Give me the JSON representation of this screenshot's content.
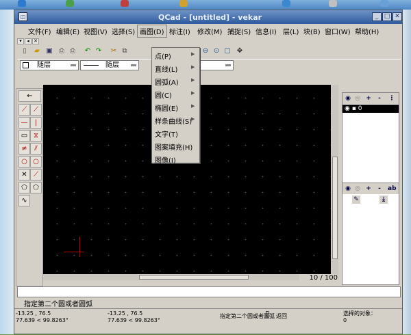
{
  "window": {
    "title": "QCad - [untitled] - vekar"
  },
  "menubar": [
    {
      "label": "文件(F)"
    },
    {
      "label": "编辑(E)"
    },
    {
      "label": "视图(V)"
    },
    {
      "label": "选择(S)"
    },
    {
      "label": "画图(D)"
    },
    {
      "label": "标注(I)"
    },
    {
      "label": "修改(M)"
    },
    {
      "label": "捕捉(S)"
    },
    {
      "label": "信息(I)"
    },
    {
      "label": "层(L)"
    },
    {
      "label": "块(B)"
    },
    {
      "label": "窗口(W)"
    },
    {
      "label": "帮助(H)"
    }
  ],
  "draw_menu": {
    "items": [
      {
        "label": "点(P)",
        "submenu": true
      },
      {
        "label": "直线(L)",
        "submenu": true
      },
      {
        "label": "圆弧(A)",
        "submenu": true
      },
      {
        "label": "圆(C)",
        "submenu": true
      },
      {
        "label": "椭圆(E)",
        "submenu": true
      },
      {
        "label": "样条曲线(S)",
        "submenu": true
      },
      {
        "label": "文字(T)",
        "submenu": false
      },
      {
        "label": "图案填充(H)",
        "submenu": false
      },
      {
        "label": "图像(I)",
        "submenu": false
      }
    ]
  },
  "pen_toolbar": {
    "color": "随层",
    "width": "随层",
    "linetype": "随层"
  },
  "canvas": {
    "zoom_label": "10 / 100"
  },
  "layer_panel": {
    "layers": [
      {
        "name": "0"
      }
    ]
  },
  "command": {
    "prompt": "指定第二个圆或者圆弧"
  },
  "status": {
    "abs_coord": "-13.25 , 76.5",
    "abs_polar": "77.639 < 99.8263°",
    "rel_coord": "-13.25 , 76.5",
    "rel_polar": "77.639 < 99.8263°",
    "hint_left": "指定第二个圆或者圆弧",
    "hint_right": "返回",
    "selected_label": "选择的对象：",
    "selected_count": "0"
  },
  "colors": {
    "titlebar": "#3a66a8",
    "canvas_bg": "#000000",
    "panel_bg": "#d4d0c8",
    "cursor": "#bb0000"
  },
  "icons": {
    "menu_arrow": "arrow-right-icon",
    "back": "arrow-left-icon"
  }
}
